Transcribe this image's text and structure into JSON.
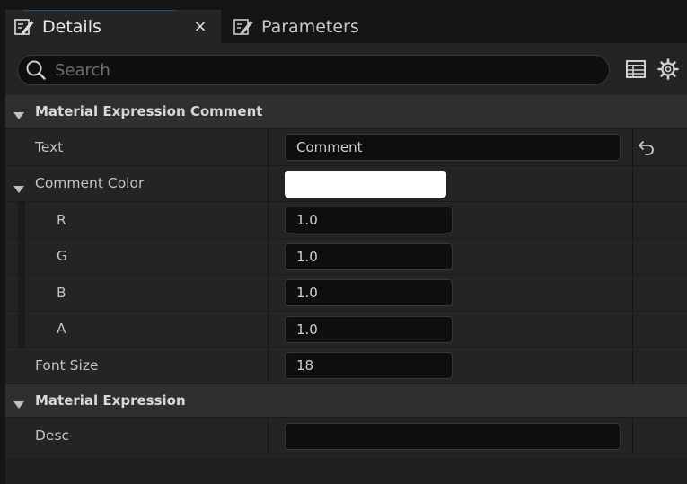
{
  "tabs": [
    {
      "label": "Details",
      "active": true,
      "icon": "edit-icon",
      "close": "×"
    },
    {
      "label": "Parameters",
      "active": false,
      "icon": "edit-icon"
    }
  ],
  "search": {
    "placeholder": "Search",
    "value": ""
  },
  "toolbar": {
    "view_options_icon": "table-icon",
    "settings_icon": "gear-icon"
  },
  "categories": [
    {
      "label": "Material Expression Comment",
      "rows": [
        {
          "name": "Text",
          "value": "Comment",
          "reset": true
        },
        {
          "name": "Comment Color",
          "color": "#ffffff",
          "expanded": true
        },
        {
          "name": "R",
          "value": "1.0"
        },
        {
          "name": "G",
          "value": "1.0"
        },
        {
          "name": "B",
          "value": "1.0"
        },
        {
          "name": "A",
          "value": "1.0"
        },
        {
          "name": "Font Size",
          "value": "18"
        }
      ]
    },
    {
      "label": "Material Expression",
      "rows": [
        {
          "name": "Desc",
          "value": ""
        }
      ]
    }
  ],
  "colors": {
    "accent": "#1d4d8a",
    "panel": "#242424",
    "category": "#2f2f2f",
    "field": "#0f0f0f"
  }
}
